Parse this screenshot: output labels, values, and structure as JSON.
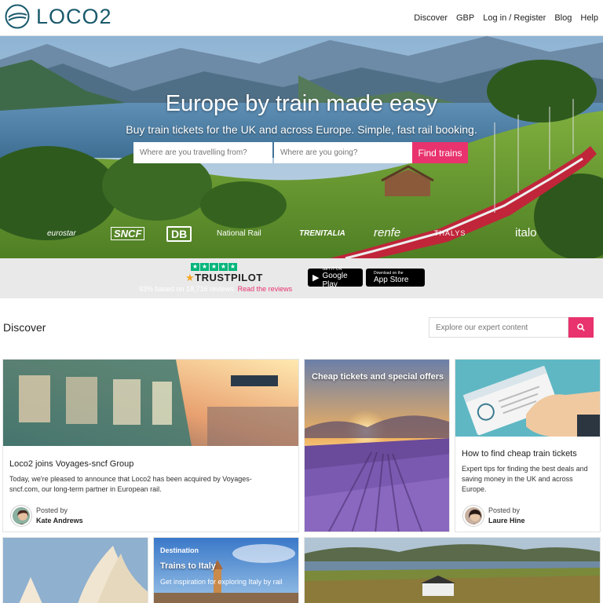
{
  "header": {
    "brand": "LOCO2",
    "nav": [
      {
        "label": "Discover"
      },
      {
        "label": "GBP"
      },
      {
        "label": "Log in / Register"
      },
      {
        "label": "Blog"
      },
      {
        "label": "Help"
      }
    ]
  },
  "hero": {
    "title": "Europe by train made easy",
    "subtitle": "Buy train tickets for the UK and across Europe. Simple, fast rail booking.",
    "from_placeholder": "Where are you travelling from?",
    "to_placeholder": "Where are you going?",
    "find_button": "Find trains",
    "partners": [
      "eurostar",
      "SNCF",
      "DB",
      "National Rail",
      "TRENITALIA",
      "renfe",
      "THALYS",
      "italo"
    ]
  },
  "trust": {
    "brand": "TRUSTPILOT",
    "stars": 5,
    "rating_text": "93% based on 18,716 reviews.",
    "read_link": "Read the reviews",
    "google_play_small": "GET IT ON",
    "google_play_big": "Google Play",
    "app_store_small": "Download on the",
    "app_store_big": "App Store"
  },
  "discover": {
    "title": "Discover",
    "search_placeholder": "Explore our expert content",
    "cards": [
      {
        "title": "Loco2 joins Voyages-sncf Group",
        "text": "Today, we're pleased to announce that Loco2 has been acquired by Voyages-sncf.com, our long-term partner in European rail.",
        "posted_by": "Posted by",
        "author": "Kate Andrews"
      },
      {
        "title": "Cheap tickets and special offers"
      },
      {
        "title": "How to find cheap train tickets",
        "text": "Expert tips for finding the best deals and saving money in the UK and across Europe.",
        "posted_by": "Posted by",
        "author": "Laure Hine"
      },
      {
        "tag": "Destination",
        "title": "Trains to Italy",
        "text": "Get inspiration for exploring Italy by rail"
      }
    ]
  },
  "colors": {
    "accent": "#e8336e",
    "brand": "#1a5a6c",
    "trustpilot_green": "#00b67a"
  }
}
